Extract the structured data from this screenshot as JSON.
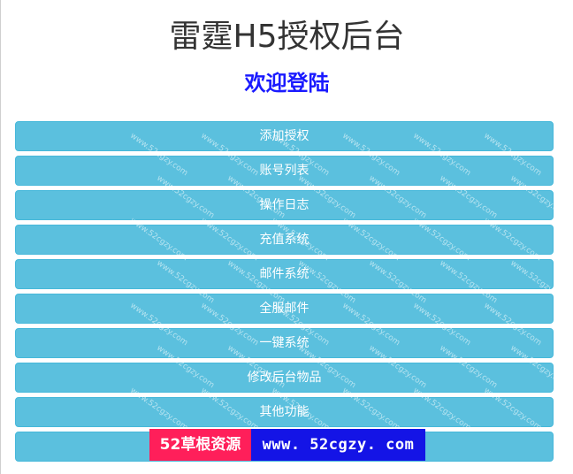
{
  "header": {
    "title": "雷霆H5授权后台",
    "subtitle": "欢迎登陆"
  },
  "menu": {
    "items": [
      {
        "label": "添加授权"
      },
      {
        "label": "账号列表"
      },
      {
        "label": "操作日志"
      },
      {
        "label": "充值系统"
      },
      {
        "label": "邮件系统"
      },
      {
        "label": "全服邮件"
      },
      {
        "label": "一键系统"
      },
      {
        "label": "修改后台物品"
      },
      {
        "label": "其他功能"
      },
      {
        "label": ""
      }
    ]
  },
  "watermark": {
    "text": "www.52cgzy.com"
  },
  "banner": {
    "left_text": "52草根资源",
    "right_text": "www. 52cgzy. com"
  },
  "colors": {
    "button_bg": "#5bc0de",
    "subtitle": "#1a1aff",
    "banner_left": "#ff1f5a",
    "banner_right": "#1414e6"
  }
}
